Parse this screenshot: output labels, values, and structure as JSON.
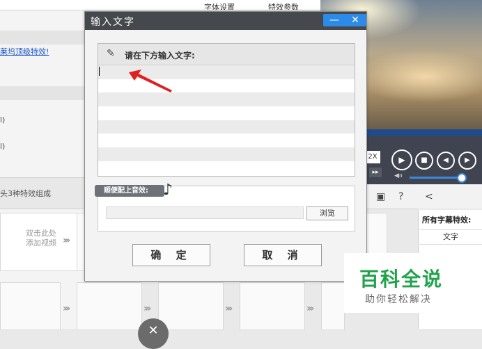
{
  "background": {
    "tab_font": "字体设置",
    "tab_effect": "特效参数",
    "effect_link": "莱坞顶级特效!",
    "paren1": "l)",
    "paren2": "l)",
    "strip_text": "头3种特效组成",
    "add_video": "双击此处\n添加视频",
    "speed": "2X",
    "effects_title": "所有字幕特效:",
    "effects_column": "文字"
  },
  "dialog": {
    "title": "输入文字",
    "edit_label": "请在下方输入文字:",
    "sound_label": "顺便配上音效:",
    "browse": "浏览",
    "ok": "确 定",
    "cancel": "取 消"
  },
  "watermark": {
    "title": "百科全说",
    "subtitle": "助你轻松解决"
  },
  "colors": {
    "titlebar": "#45484d",
    "window_buttons": "#2d8be8",
    "watermark_green": "#1fa34a",
    "arrow_red": "#e02020"
  }
}
